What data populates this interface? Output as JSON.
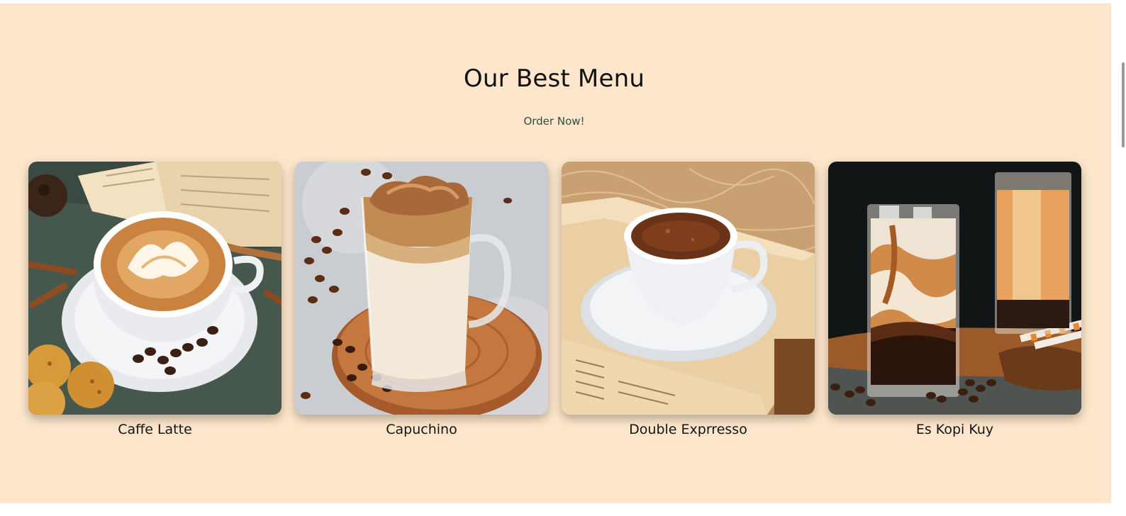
{
  "section": {
    "title": "Our Best Menu",
    "subtitle": "Order Now!"
  },
  "menu": {
    "items": [
      {
        "name": "Caffe Latte",
        "image_icon": "latte-art-cup-photo"
      },
      {
        "name": "Capuchino",
        "image_icon": "whipped-coffee-glass-photo"
      },
      {
        "name": "Double Exprresso",
        "image_icon": "espresso-cup-photo"
      },
      {
        "name": "Es Kopi Kuy",
        "image_icon": "iced-coffee-glasses-photo"
      }
    ]
  },
  "colors": {
    "background": "#fde6cb",
    "title": "#111111",
    "subtitle": "#2f5045"
  }
}
